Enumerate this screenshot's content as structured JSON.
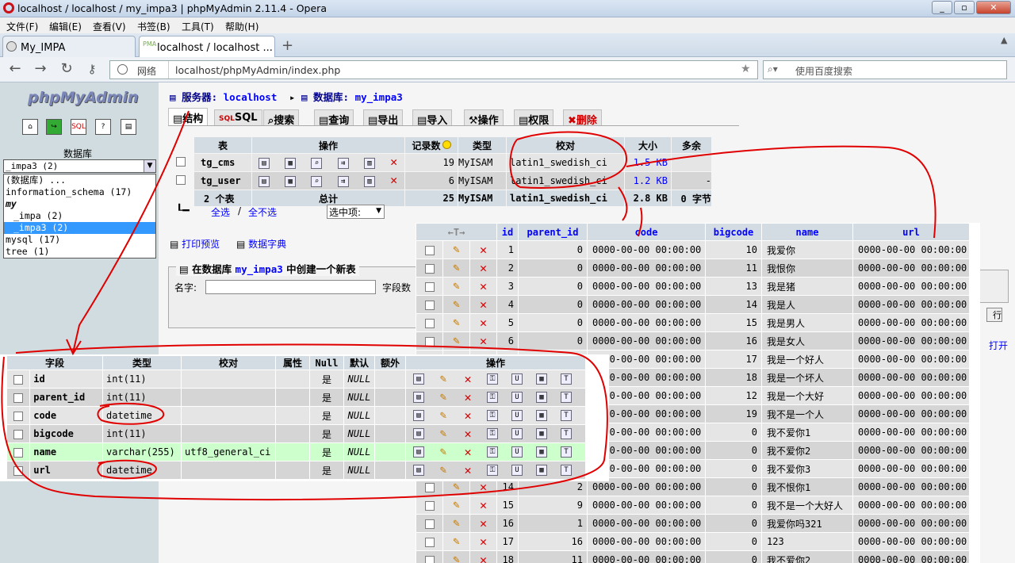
{
  "window": {
    "title": "localhost / localhost / my_impa3 | phpMyAdmin 2.11.4 - Opera"
  },
  "menu": [
    "文件(F)",
    "编辑(E)",
    "查看(V)",
    "书签(B)",
    "工具(T)",
    "帮助(H)"
  ],
  "tabs": [
    {
      "label": "My_IMPA"
    },
    {
      "label": "localhost / localhost ..."
    }
  ],
  "address": {
    "net_label": "网络",
    "url": "localhost/phpMyAdmin/index.php",
    "search_placeholder": "使用百度搜索"
  },
  "left": {
    "logo": "phpMyAdmin",
    "db_label": "数据库",
    "db_select": "_impa3 (2)",
    "db_list": [
      "(数据库) ...",
      "information_schema (17)",
      "my",
      "_impa (2)",
      "_impa3 (2)",
      "mysql (17)",
      "tree (1)"
    ]
  },
  "breadcrumb": {
    "server_label": "服务器:",
    "server": "localhost",
    "db_label": "数据库:",
    "db": "my_impa3"
  },
  "subtabs": [
    "结构",
    "SQL",
    "搜索",
    "查询",
    "导出",
    "导入",
    "操作",
    "权限",
    "删除"
  ],
  "table_list": {
    "headers": [
      "表",
      "操作",
      "记录数",
      "类型",
      "校对",
      "大小",
      "多余"
    ],
    "rows": [
      {
        "name": "tg_cms",
        "records": "19",
        "type": "MyISAM",
        "collation": "latin1_swedish_ci",
        "size": "1.5 KB",
        "overhead": ""
      },
      {
        "name": "tg_user",
        "records": "6",
        "type": "MyISAM",
        "collation": "latin1_swedish_ci",
        "size": "1.2 KB",
        "overhead": "-"
      }
    ],
    "summary": {
      "count": "2 个表",
      "total_label": "总计",
      "records": "25",
      "type": "MyISAM",
      "collation": "latin1_swedish_ci",
      "size": "2.8 KB",
      "overhead": "0 字节"
    },
    "check_all": "全选",
    "separator": "/",
    "uncheck_all": "全不选",
    "with_selected": "选中项:"
  },
  "tools": {
    "print": "打印预览",
    "dict": "数据字典"
  },
  "create": {
    "legend_pre": "在数据库",
    "db": "my_impa3",
    "legend_post": "中创建一个新表",
    "name_label": "名字:",
    "fields_label": "字段数"
  },
  "partial": {
    "go": "行",
    "print": "打开"
  },
  "data_table": {
    "headers": [
      "id",
      "parent_id",
      "code",
      "bigcode",
      "name",
      "url"
    ],
    "rows": [
      [
        "1",
        "0",
        "0000-00-00 00:00:00",
        "10",
        "我爱你",
        "0000-00-00 00:00:00"
      ],
      [
        "2",
        "0",
        "0000-00-00 00:00:00",
        "11",
        "我恨你",
        "0000-00-00 00:00:00"
      ],
      [
        "3",
        "0",
        "0000-00-00 00:00:00",
        "13",
        "我是猪",
        "0000-00-00 00:00:00"
      ],
      [
        "4",
        "0",
        "0000-00-00 00:00:00",
        "14",
        "我是人",
        "0000-00-00 00:00:00"
      ],
      [
        "5",
        "0",
        "0000-00-00 00:00:00",
        "15",
        "我是男人",
        "0000-00-00 00:00:00"
      ],
      [
        "6",
        "0",
        "0000-00-00 00:00:00",
        "16",
        "我是女人",
        "0000-00-00 00:00:00"
      ],
      [
        "",
        "",
        "0000-00-00 00:00:00",
        "17",
        "我是一个好人",
        "0000-00-00 00:00:00"
      ],
      [
        "",
        "",
        "0000-00-00 00:00:00",
        "18",
        "我是一个坏人",
        "0000-00-00 00:00:00"
      ],
      [
        "",
        "",
        "0000-00-00 00:00:00",
        "12",
        "我是一个大好",
        "0000-00-00 00:00:00"
      ],
      [
        "",
        "",
        "0000-00-00 00:00:00",
        "19",
        "我不是一个人",
        "0000-00-00 00:00:00"
      ],
      [
        "",
        "",
        "0000-00-00 00:00:00",
        "0",
        "我不爱你1",
        "0000-00-00 00:00:00"
      ],
      [
        "",
        "",
        "0000-00-00 00:00:00",
        "0",
        "我不爱你2",
        "0000-00-00 00:00:00"
      ],
      [
        "",
        "",
        "0000-00-00 00:00:00",
        "0",
        "我不爱你3",
        "0000-00-00 00:00:00"
      ],
      [
        "14",
        "2",
        "0000-00-00 00:00:00",
        "0",
        "我不恨你1",
        "0000-00-00 00:00:00"
      ],
      [
        "15",
        "9",
        "0000-00-00 00:00:00",
        "0",
        "我不是一个大好人",
        "0000-00-00 00:00:00"
      ],
      [
        "16",
        "1",
        "0000-00-00 00:00:00",
        "0",
        "我爱你吗321",
        "0000-00-00 00:00:00"
      ],
      [
        "17",
        "16",
        "0000-00-00 00:00:00",
        "0",
        "123",
        "0000-00-00 00:00:00"
      ],
      [
        "18",
        "11",
        "0000-00-00 00:00:00",
        "0",
        "我不爱你2",
        "0000-00-00 00:00:00"
      ]
    ]
  },
  "structure": {
    "headers": [
      "字段",
      "类型",
      "校对",
      "属性",
      "Null",
      "默认",
      "额外",
      "操作"
    ],
    "rows": [
      {
        "field": "id",
        "type": "int(11)",
        "collation": "",
        "null": "是",
        "default": "NULL"
      },
      {
        "field": "parent_id",
        "type": "int(11)",
        "collation": "",
        "null": "是",
        "default": "NULL"
      },
      {
        "field": "code",
        "type": "datetime",
        "collation": "",
        "null": "是",
        "default": "NULL"
      },
      {
        "field": "bigcode",
        "type": "int(11)",
        "collation": "",
        "null": "是",
        "default": "NULL"
      },
      {
        "field": "name",
        "type": "varchar(255)",
        "collation": "utf8_general_ci",
        "null": "是",
        "default": "NULL"
      },
      {
        "field": "url",
        "type": "datetime",
        "collation": "",
        "null": "是",
        "default": "NULL"
      }
    ]
  },
  "colors": {
    "annotation": "#e00000",
    "header_bg": "#d3dce3",
    "row_odd": "#e5e5e5",
    "row_even": "#d5d5d5",
    "highlight": "#ccffcc"
  }
}
